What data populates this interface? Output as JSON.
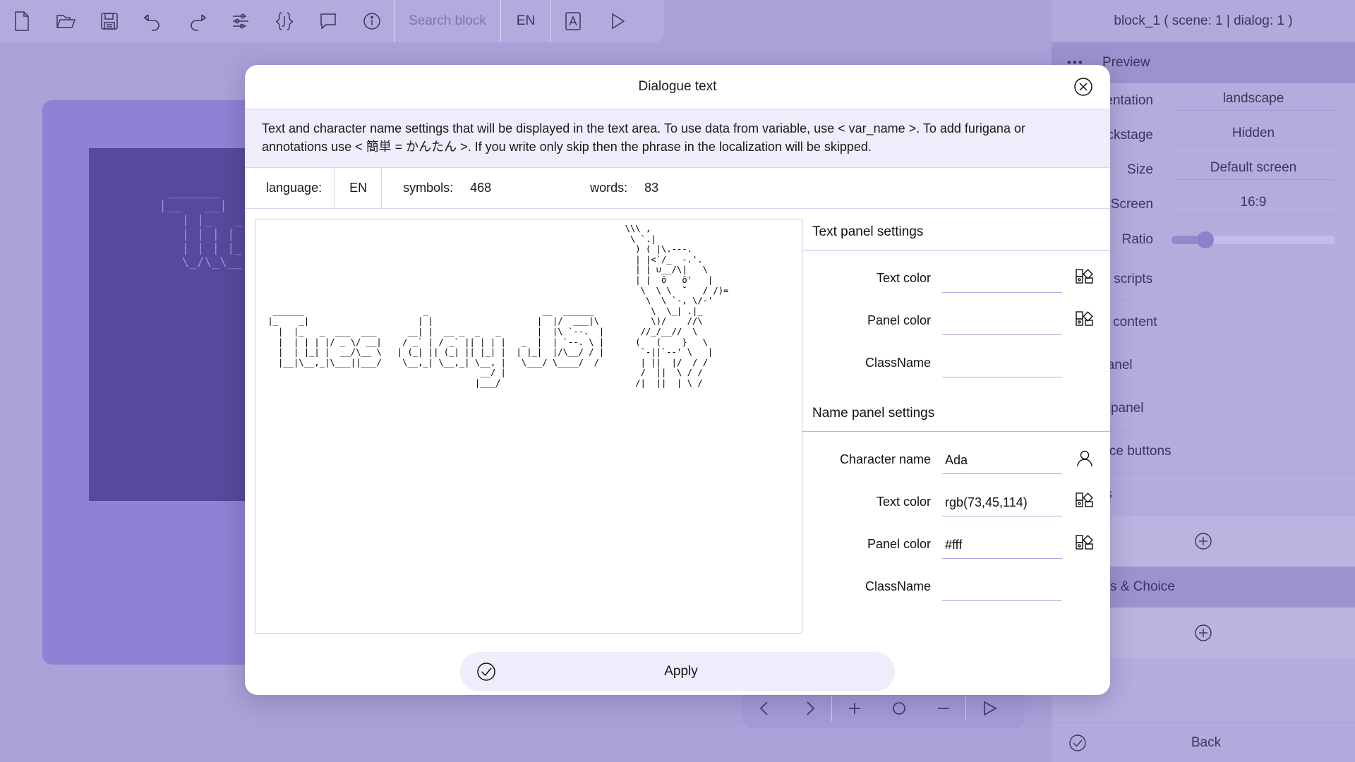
{
  "toolbar": {
    "icons": [
      {
        "name": "new-file-icon",
        "label": "New file"
      },
      {
        "name": "open-folder-icon",
        "label": "Open"
      },
      {
        "name": "save-disk-icon",
        "label": "Save"
      },
      {
        "name": "undo-icon",
        "label": "Undo"
      },
      {
        "name": "redo-icon",
        "label": "Redo"
      },
      {
        "name": "settings-sliders-icon",
        "label": "Settings"
      },
      {
        "name": "json-braces-icon",
        "label": "JSON"
      },
      {
        "name": "comment-bubble-icon",
        "label": "Comment"
      },
      {
        "name": "info-icon",
        "label": "Info"
      }
    ],
    "search_placeholder": "Search block",
    "language_label": "EN",
    "font_icon": "font-icon",
    "play_icon": "play-icon"
  },
  "scene": {
    "ascii_preview": "   _______\n  |__   __|\n     | |_   _\n     | | | | |\n     | | | |_| |\n     \\_/\\_\\__,_|"
  },
  "player_bar": {
    "prev_icon": "chevron-left-icon",
    "next_icon": "chevron-right-icon",
    "add_icon": "plus-icon",
    "circle_icon": "circle-icon",
    "remove_icon": "minus-icon",
    "play_icon": "play-icon"
  },
  "sidebar": {
    "title": "block_1 ( scene: 1 | dialog: 1 )",
    "preview_section": "Preview",
    "preview_rows": [
      {
        "label": "Orientation",
        "value": "landscape"
      },
      {
        "label": "Backstage",
        "value": "Hidden"
      },
      {
        "label": "Size",
        "value": "Default screen"
      },
      {
        "label": "Screen",
        "value": "16:9"
      }
    ],
    "ratio_label": "Ratio",
    "list_items": [
      "Object scripts",
      "Scene content",
      "Text panel",
      "Name panel",
      "Interface buttons",
      "Effects"
    ],
    "buttons_choice_section": "Buttons & Choice",
    "add_icon": "plus-circle-icon",
    "back_label": "Back",
    "back_icon": "check-circle-icon"
  },
  "modal": {
    "title": "Dialogue text",
    "close_icon": "close-circle-icon",
    "description": "Text and character name settings that will be displayed in the text area. To use data from variable, use < var_name >. To add furigana or annotations use < 簡単 = かんたん >. If you write only skip then the phrase in the localization will be skipped.",
    "meta": {
      "language_label": "language:",
      "language_value": "EN",
      "symbols_label": "symbols:",
      "symbols_value": "468",
      "words_label": "words:",
      "words_value": "83"
    },
    "dialogue_text": "                                                                      \\\\\\ ,\n                                                                       \\ `.|\n                                                                        ) ( |\\.---.\n                                                                        | |<`/_  -.'.\n                                                                        | | ∪__/\\|   \\\n                                                                        | |  ō   ō'   |\n                                                                         \\  \\ \\  ˘   / /)=\n                                                                          \\  \\ `-, \\/-'\n  ______                       _                      __  ______           \\  \\_| .|_\n |_    _|                     | |                    |  |/  ___|\\          \\)/    //\\\n   |  |_   _  ___  ___      __| |  __ _  _   _       |  |\\ `--.  |       //_/__//  \\\n   |  | | | |/ _ \\/ __|    / _` | / _` || | | |   _  |  | `--. \\ |      (   (    }   \\\n   |  | |_| |  __/\\__ \\   | (_| || (_| || |_| |  | |_|  |/\\__/ / |       `-||`--' \\   |\n   |__|\\__,_|\\___||___/    \\__,_| \\__,_| \\__, |   \\___/ \\____/  /        | ||  |/  / /\n                                          __/ |                          /  ||  \\ / /\n                                         |___/                          /|  ||  | \\ /",
    "text_panel": {
      "header": "Text panel settings",
      "rows": [
        {
          "label": "Text color",
          "value": "",
          "icon": "color-picker-icon"
        },
        {
          "label": "Panel color",
          "value": "",
          "icon": "color-picker-icon"
        },
        {
          "label": "ClassName",
          "value": "",
          "icon": ""
        }
      ]
    },
    "name_panel": {
      "header": "Name panel settings",
      "rows": [
        {
          "label": "Character name",
          "value": "Ada",
          "icon": "person-icon"
        },
        {
          "label": "Text color",
          "value": "rgb(73,45,114)",
          "icon": "color-picker-icon"
        },
        {
          "label": "Panel color",
          "value": "#fff",
          "icon": "color-picker-icon"
        },
        {
          "label": "ClassName",
          "value": "",
          "icon": ""
        }
      ]
    },
    "apply_label": "Apply",
    "apply_icon": "check-circle-icon"
  },
  "colors": {
    "app_bg": "#a9a1d8",
    "toolbar_bg": "#b3abdd",
    "card_bg": "#8d82d4",
    "scene_bg": "#57499b",
    "modal_bg": "#ffffff",
    "desc_bg": "#eeedfb",
    "accent_line": "#b0a8e0",
    "text_dark": "#3c3560"
  }
}
